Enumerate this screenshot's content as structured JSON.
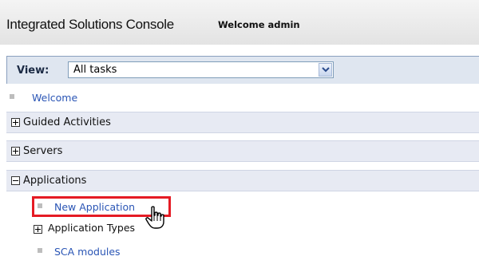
{
  "header": {
    "app_title": "Integrated Solutions Console",
    "welcome_text": "Welcome admin"
  },
  "view": {
    "label": "View:",
    "selected": "All tasks"
  },
  "nav": {
    "welcome_link": "Welcome",
    "sections": [
      {
        "label": "Guided Activities",
        "state": "collapsed"
      },
      {
        "label": "Servers",
        "state": "collapsed"
      },
      {
        "label": "Applications",
        "state": "expanded"
      }
    ],
    "applications_items": [
      {
        "label": "New Application",
        "type": "link"
      },
      {
        "label": "Application Types",
        "type": "expandable"
      },
      {
        "label": "SCA modules",
        "type": "link"
      }
    ]
  },
  "colors": {
    "link": "#2a55b5",
    "highlight": "#e51b24"
  }
}
